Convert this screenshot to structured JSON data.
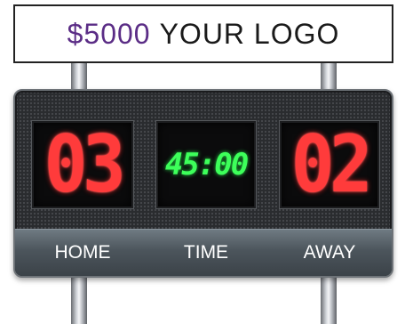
{
  "sign": {
    "price": "$5000",
    "text": "YOUR LOGO",
    "price_color": "#5b2d86"
  },
  "scoreboard": {
    "home_score": "03",
    "time": "45:00",
    "away_score": "02",
    "home_label": "HOME",
    "time_label": "TIME",
    "away_label": "AWAY",
    "score_color": "#ff3b3b",
    "time_color": "#3dff5a"
  }
}
